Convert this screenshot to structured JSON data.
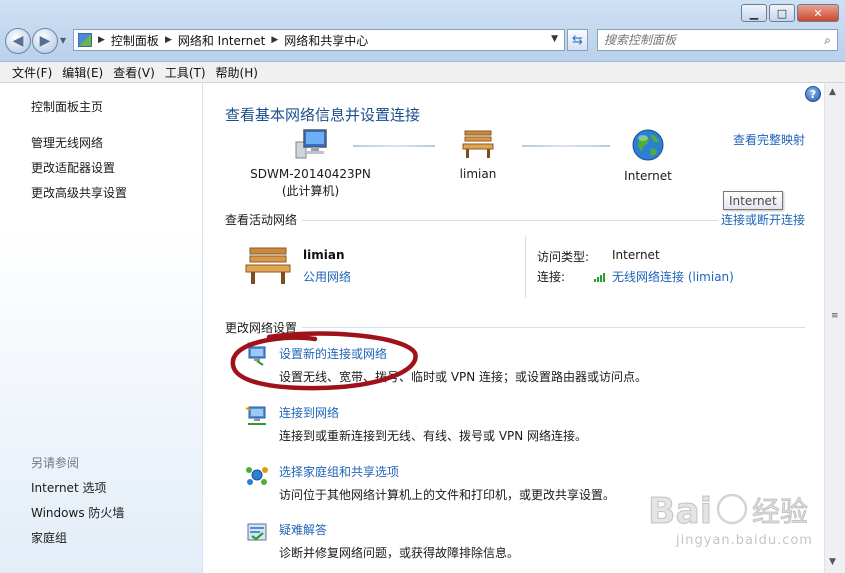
{
  "window": {
    "minimize_glyph": "▁",
    "maximize_glyph": "□",
    "close_glyph": "✕"
  },
  "address": {
    "breadcrumbs": [
      "控制面板",
      "网络和 Internet",
      "网络和共享中心"
    ],
    "search_placeholder": "搜索控制面板"
  },
  "menu": [
    "文件(F)",
    "编辑(E)",
    "查看(V)",
    "工具(T)",
    "帮助(H)"
  ],
  "sidebar": {
    "items": [
      "控制面板主页",
      "管理无线网络",
      "更改适配器设置",
      "更改高级共享设置"
    ],
    "see_also_title": "另请参阅",
    "see_also": [
      "Internet 选项",
      "Windows 防火墙",
      "家庭组"
    ]
  },
  "main": {
    "title": "查看基本网络信息并设置连接",
    "full_map_link": "查看完整映射",
    "map": {
      "computer_name": "SDWM-20140423PN",
      "computer_sub": "(此计算机)",
      "network_name": "limian",
      "internet_name": "Internet",
      "tooltip": "Internet"
    },
    "active": {
      "heading": "查看活动网络",
      "connect_link": "连接或断开连接",
      "name": "limian",
      "type": "公用网络",
      "access_label": "访问类型:",
      "access_value": "Internet",
      "connection_label": "连接:",
      "connection_value": "无线网络连接 (limian)"
    },
    "change": {
      "heading": "更改网络设置",
      "tasks": [
        {
          "link": "设置新的连接或网络",
          "desc": "设置无线、宽带、拨号、临时或 VPN 连接；或设置路由器或访问点。",
          "icon": "new-connection-icon"
        },
        {
          "link": "连接到网络",
          "desc": "连接到或重新连接到无线、有线、拨号或 VPN 网络连接。",
          "icon": "connect-network-icon"
        },
        {
          "link": "选择家庭组和共享选项",
          "desc": "访问位于其他网络计算机上的文件和打印机，或更改共享设置。",
          "icon": "homegroup-icon"
        },
        {
          "link": "疑难解答",
          "desc": "诊断并修复网络问题，或获得故障排除信息。",
          "icon": "troubleshoot-icon"
        }
      ]
    }
  },
  "watermark": {
    "text": "jingyan.baidu.com"
  },
  "colors": {
    "link": "#1f64b9",
    "title": "#1c4f8c",
    "annotation": "#a0121a"
  }
}
